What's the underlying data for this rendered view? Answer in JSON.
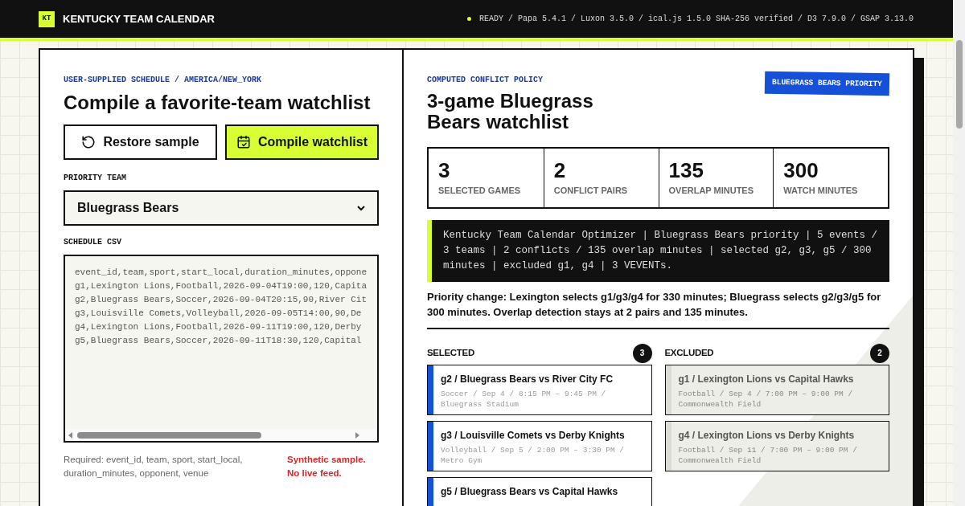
{
  "header": {
    "logo": "KT",
    "title": "KENTUCKY TEAM CALENDAR",
    "status": "READY / Papa 5.4.1 / Luxon 3.5.0 / ical.js 1.5.0 SHA-256 verified / D3 7.9.0 / GSAP 3.13.0"
  },
  "left": {
    "eyebrow": "USER-SUPPLIED SCHEDULE / AMERICA/NEW_YORK",
    "heading": "Compile a favorite-team watchlist",
    "buttons": [
      {
        "label": "Restore sample",
        "kind": "restore"
      },
      {
        "label": "Compile watchlist",
        "kind": "compile"
      }
    ],
    "priority_label": "PRIORITY TEAM",
    "priority_value": "Bluegrass Bears",
    "csv_label": "SCHEDULE CSV",
    "csv_lines": [
      "event_id,team,sport,start_local,duration_minutes,oppone",
      "g1,Lexington Lions,Football,2026-09-04T19:00,120,Capita",
      "g2,Bluegrass Bears,Soccer,2026-09-04T20:15,90,River Cit",
      "g3,Louisville Comets,Volleyball,2026-09-05T14:00,90,De",
      "g4,Lexington Lions,Football,2026-09-11T19:00,120,Derby",
      "g5,Bluegrass Bears,Soccer,2026-09-11T18:30,120,Capital"
    ],
    "required_note": "Required: event_id, team, sport, start_local, duration_minutes, opponent, venue",
    "warning": [
      "Synthetic sample.",
      "No live feed."
    ]
  },
  "right": {
    "eyebrow": "COMPUTED CONFLICT POLICY",
    "heading": "3-game Bluegrass Bears watchlist",
    "badge": "BLUEGRASS BEARS PRIORITY",
    "stats": [
      {
        "value": "3",
        "label": "SELECTED GAMES"
      },
      {
        "value": "2",
        "label": "CONFLICT PAIRS"
      },
      {
        "value": "135",
        "label": "OVERLAP MINUTES"
      },
      {
        "value": "300",
        "label": "WATCH MINUTES"
      }
    ],
    "summary": "Kentucky Team Calendar Optimizer | Bluegrass Bears priority | 5 events / 3 teams | 2 conflicts / 135 overlap minutes | selected g2, g3, g5 / 300 minutes | excluded g1, g4 | 3 VEVENTs.",
    "priority_change": "Priority change: Lexington selects g1/g3/g4 for 330 minutes; Bluegrass selects g2/g3/g5 for 300 minutes. Overlap detection stays at 2 pairs and 135 minutes.",
    "groups": [
      {
        "kind": "selected",
        "title": "SELECTED",
        "count": "3",
        "games": [
          {
            "title": "g2 / Bluegrass Bears vs River City FC",
            "meta": "Soccer / Sep 4 / 8:15 PM – 9:45 PM / Bluegrass Stadium"
          },
          {
            "title": "g3 / Louisville Comets vs Derby Knights",
            "meta": "Volleyball / Sep 5 / 2:00 PM – 3:30 PM / Metro Gym"
          },
          {
            "title": "g5 / Bluegrass Bears vs Capital Hawks"
          }
        ]
      },
      {
        "kind": "excluded",
        "title": "EXCLUDED",
        "count": "2",
        "games": [
          {
            "title": "g1 / Lexington Lions vs Capital Hawks",
            "meta": "Football / Sep 4 / 7:00 PM – 9:00 PM / Commonwealth Field"
          },
          {
            "title": "g4 / Lexington Lions vs Derby Knights",
            "meta": "Football / Sep 11 / 7:00 PM – 9:00 PM / Commonwealth Field"
          }
        ]
      }
    ]
  }
}
